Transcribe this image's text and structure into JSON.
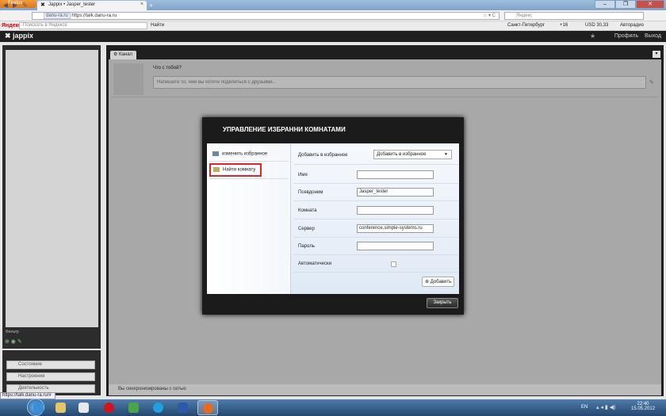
{
  "browser": {
    "menu_button": "Firefox",
    "tab_title": "Jappix • Jasper_tester",
    "tab_close": "×",
    "new_tab": "+",
    "window_controls": [
      "–",
      "❐",
      "✕"
    ],
    "url_domain": "danu-ra.ru",
    "url": "https://talk.danu-ra.ru",
    "url_star": "☆ ▾ C",
    "search_placeholder": "Яндекс",
    "status_url": "https://talk.danu-ra.ru/#"
  },
  "yandex_bar": {
    "logo": "Яндекс",
    "search_placeholder": "Поискать в Яндексе",
    "find_button": "Найти",
    "city": "Санкт-Петербург",
    "temperature": "+16",
    "currency": "USD 30,33",
    "radio": "Авторадио"
  },
  "jappix": {
    "logo": "jappix",
    "header_links": [
      "Профиль",
      "Выход"
    ],
    "filter_label": "Фильтр",
    "left_buttons": [
      "Состояние",
      "Настроения",
      "Деятельность"
    ],
    "channel_tab": "Канал",
    "whatsup": "Что с тобой?",
    "post_placeholder": "Напишите то, чем вы хотите поделиться с друзьями...",
    "status_bar": "Вы синхронизированы с сетью"
  },
  "modal": {
    "title": "УПРАВЛЕНИЕ ИЗБРАННИ КОМНАТАМИ",
    "menu": [
      "изменить избранное",
      "Найти комнату"
    ],
    "add_to_favorites_label": "Добавить в избранное",
    "add_to_favorites_select": "Добавить в избранное",
    "fields": {
      "name_label": "Имя",
      "name_value": "",
      "nick_label": "Псевдоним",
      "nick_value": "Jasper_tester",
      "room_label": "Комната",
      "room_value": "",
      "server_label": "Сервер",
      "server_value": "conference.simple-systems.ru",
      "password_label": "Пароль",
      "password_value": "",
      "auto_label": "Автоматически"
    },
    "add_button": "Добавить",
    "close_button": "Закрыть"
  },
  "taskbar": {
    "language": "EN",
    "time": "22:40",
    "date": "15.05.2012"
  },
  "colors": {
    "highlight_border": "#d9272e",
    "taskbar": "#24466e"
  }
}
